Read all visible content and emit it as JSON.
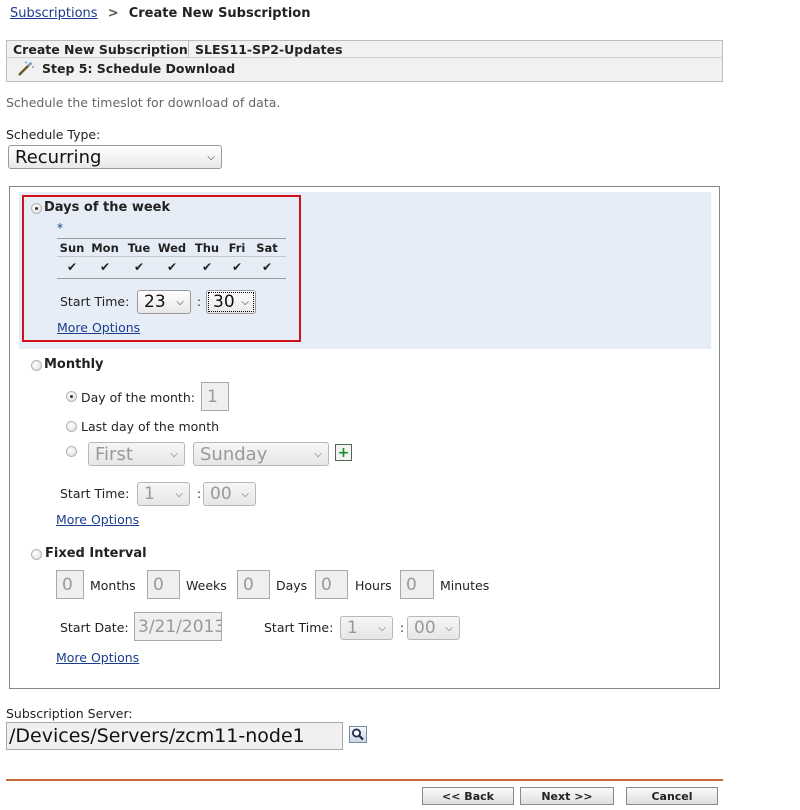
{
  "breadcrumb": {
    "parent": "Subscriptions",
    "current": "Create New Subscription"
  },
  "header": {
    "tab_label": "Create New Subscription",
    "subscription_name": "SLES11-SP2-Updates",
    "step_title": "Step 5: Schedule Download"
  },
  "description": "Schedule the timeslot for download of data.",
  "schedule_type": {
    "label": "Schedule Type:",
    "selected": "Recurring"
  },
  "days_of_week": {
    "label": "Days of the week",
    "selected": true,
    "required_marker": "*",
    "days": [
      "Sun",
      "Mon",
      "Tue",
      "Wed",
      "Thu",
      "Fri",
      "Sat"
    ],
    "checked": [
      true,
      true,
      true,
      true,
      true,
      true,
      true
    ],
    "start_time_label": "Start Time:",
    "hour": "23",
    "separator": ":",
    "minute": "30",
    "more_options": "More Options"
  },
  "monthly": {
    "label": "Monthly",
    "day_of_month_label": "Day of the month:",
    "day_of_month_value": "1",
    "last_day_label": "Last day of the month",
    "ordinal": "First",
    "weekday": "Sunday",
    "start_time_label": "Start Time:",
    "hour": "1",
    "separator": ":",
    "minute": "00",
    "more_options": "More Options"
  },
  "fixed_interval": {
    "label": "Fixed Interval",
    "months_value": "0",
    "months_label": "Months",
    "weeks_value": "0",
    "weeks_label": "Weeks",
    "days_value": "0",
    "days_label": "Days",
    "hours_value": "0",
    "hours_label": "Hours",
    "minutes_value": "0",
    "minutes_label": "Minutes",
    "start_date_label": "Start Date:",
    "start_date_value": "3/21/2013",
    "start_time_label": "Start Time:",
    "hour": "1",
    "separator": ":",
    "minute": "00",
    "more_options": "More Options"
  },
  "subscription_server": {
    "label": "Subscription Server:",
    "value": "/Devices/Servers/zcm11-node1"
  },
  "buttons": {
    "back": "<< Back",
    "next": "Next >>",
    "cancel": "Cancel"
  },
  "colors": {
    "link": "#1a3d8f",
    "highlight_border": "#d0101a",
    "selected_band": "#e7edf7",
    "footer_rule": "#c86a3a"
  }
}
